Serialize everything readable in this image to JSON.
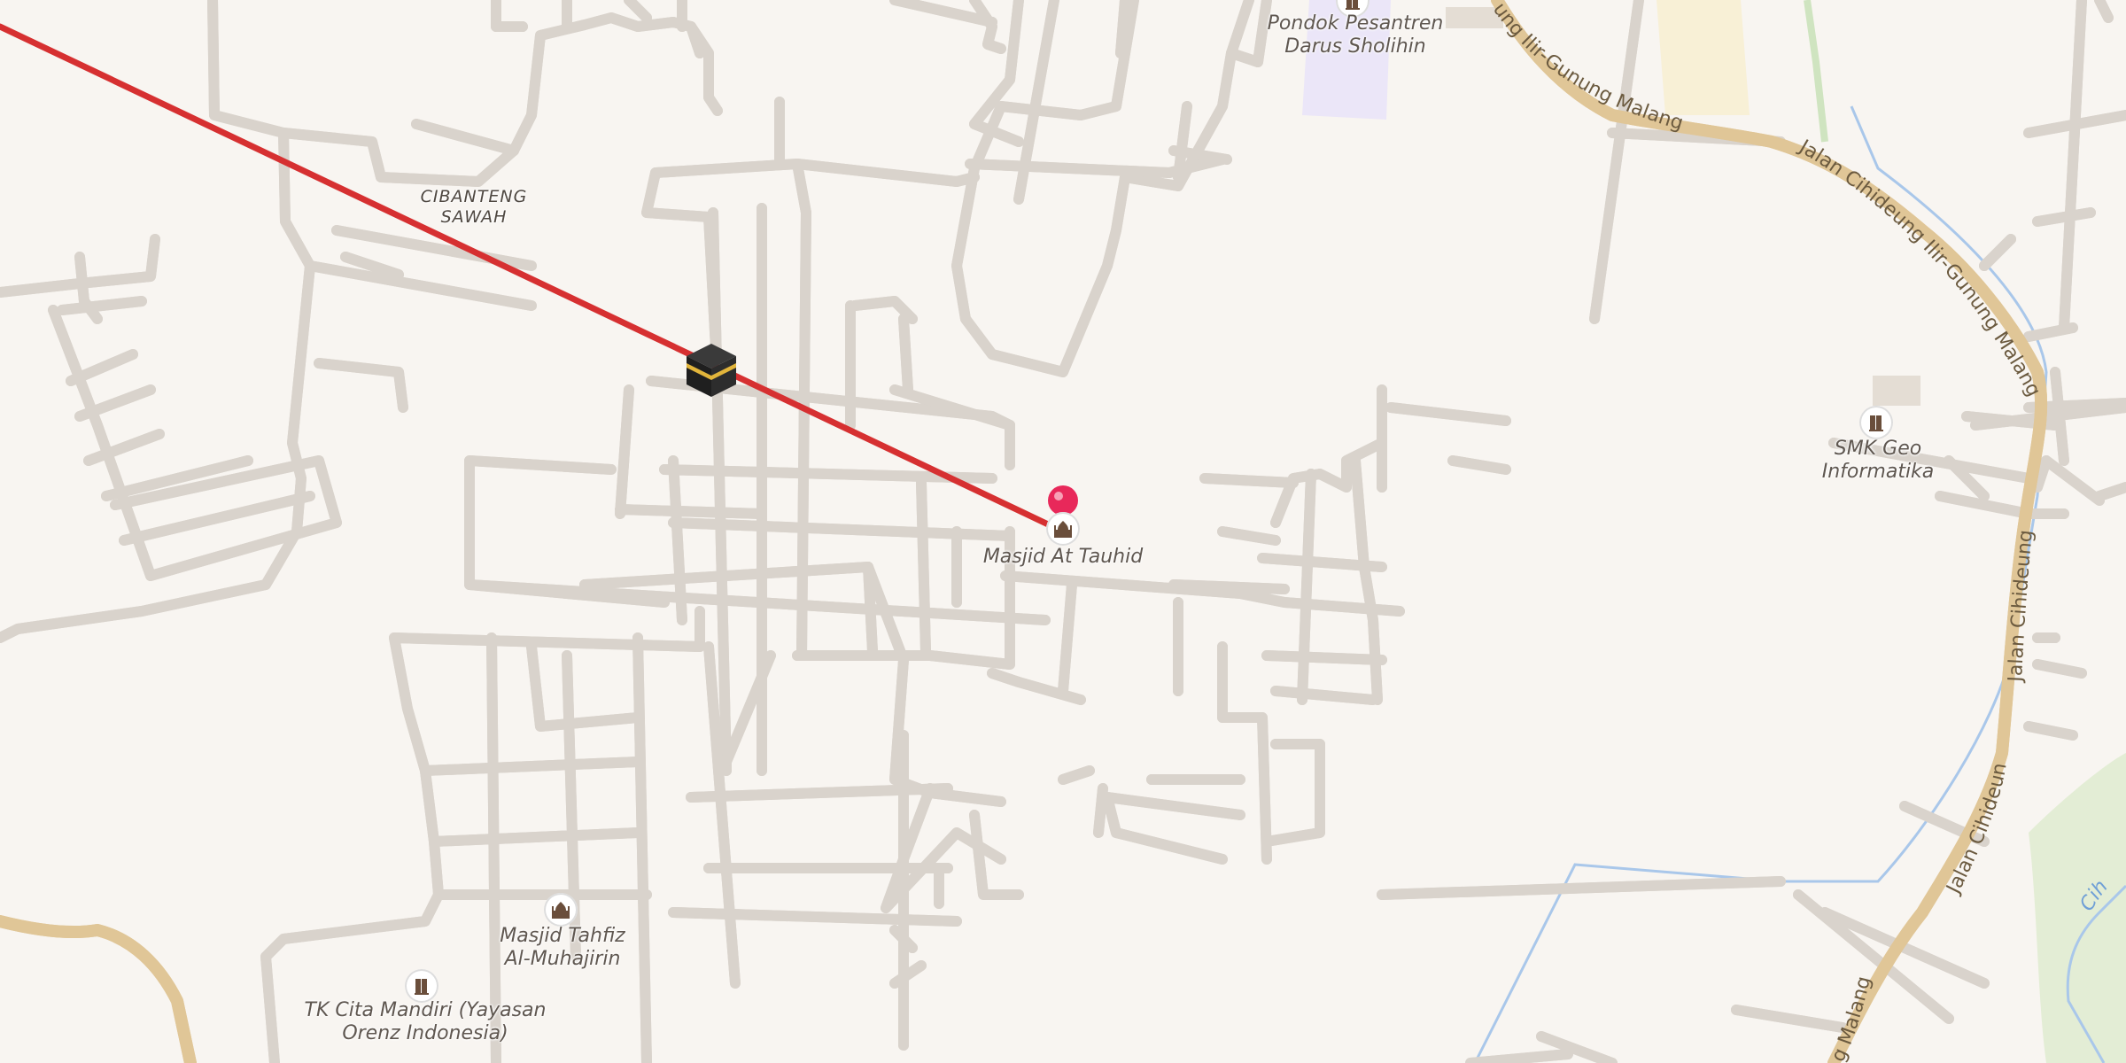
{
  "map": {
    "route_color": "#d63031",
    "pin_color": "#e8285a",
    "road_major_color": "#f6d9a0",
    "water_color": "#a9c7ea"
  },
  "places": {
    "cibanteng_sawah_line1": "CIBANTENG",
    "cibanteng_sawah_line2": "SAWAH"
  },
  "pois": {
    "masjid_at_tauhid": "Masjid At Tauhid",
    "pondok_line1": "Pondok Pesantren",
    "pondok_line2": "Darus Sholihin",
    "smk_line1": "SMK Geo",
    "smk_line2": "Informatika",
    "masjid_tahfiz_line1": "Masjid Tahfiz",
    "masjid_tahfiz_line2": "Al-Muhajirin",
    "tk_line1": "TK Cita Mandiri (Yayasan",
    "tk_line2": "Orenz Indonesia)"
  },
  "streets": {
    "gunung_malang_top": "ung Ilir-Gunung Malang",
    "jalan_cihideung_upper": "Jalan Cihideung Ilir-Gunung Malang",
    "jalan_cihideung_lower": "Jalan Cihideung Ilir-Gunung Malang",
    "jalan_cihideung_diag": "Jalan Cihideung Ilir-Gunung Malang",
    "malang_bottom": "g Malang",
    "river": "Cih"
  },
  "icons": {
    "kaaba": "kaaba-icon",
    "mosque": "mosque-icon",
    "school": "school-icon",
    "pin": "location-pin-icon"
  }
}
